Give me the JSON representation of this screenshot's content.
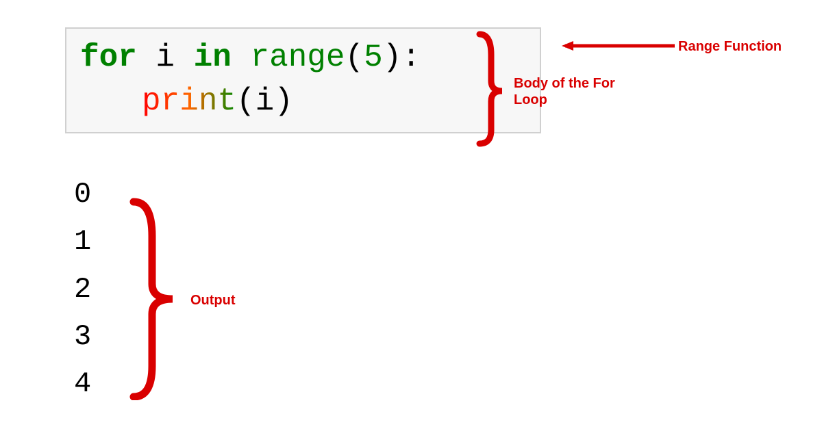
{
  "code": {
    "line1": {
      "kw_for": "for",
      "var": " i ",
      "kw_in": "in",
      "space": " ",
      "range_fn": "range",
      "open_paren": "(",
      "arg": "5",
      "close_paren": ")",
      "colon": ":"
    },
    "line2": {
      "print_fn": "print",
      "open_paren": "(",
      "arg": "i",
      "close_paren": ")"
    }
  },
  "output": {
    "lines": [
      "0",
      "1",
      "2",
      "3",
      "4"
    ]
  },
  "annotations": {
    "range_label": "Range Function",
    "body_label": "Body of the For Loop",
    "output_label": "Output"
  }
}
